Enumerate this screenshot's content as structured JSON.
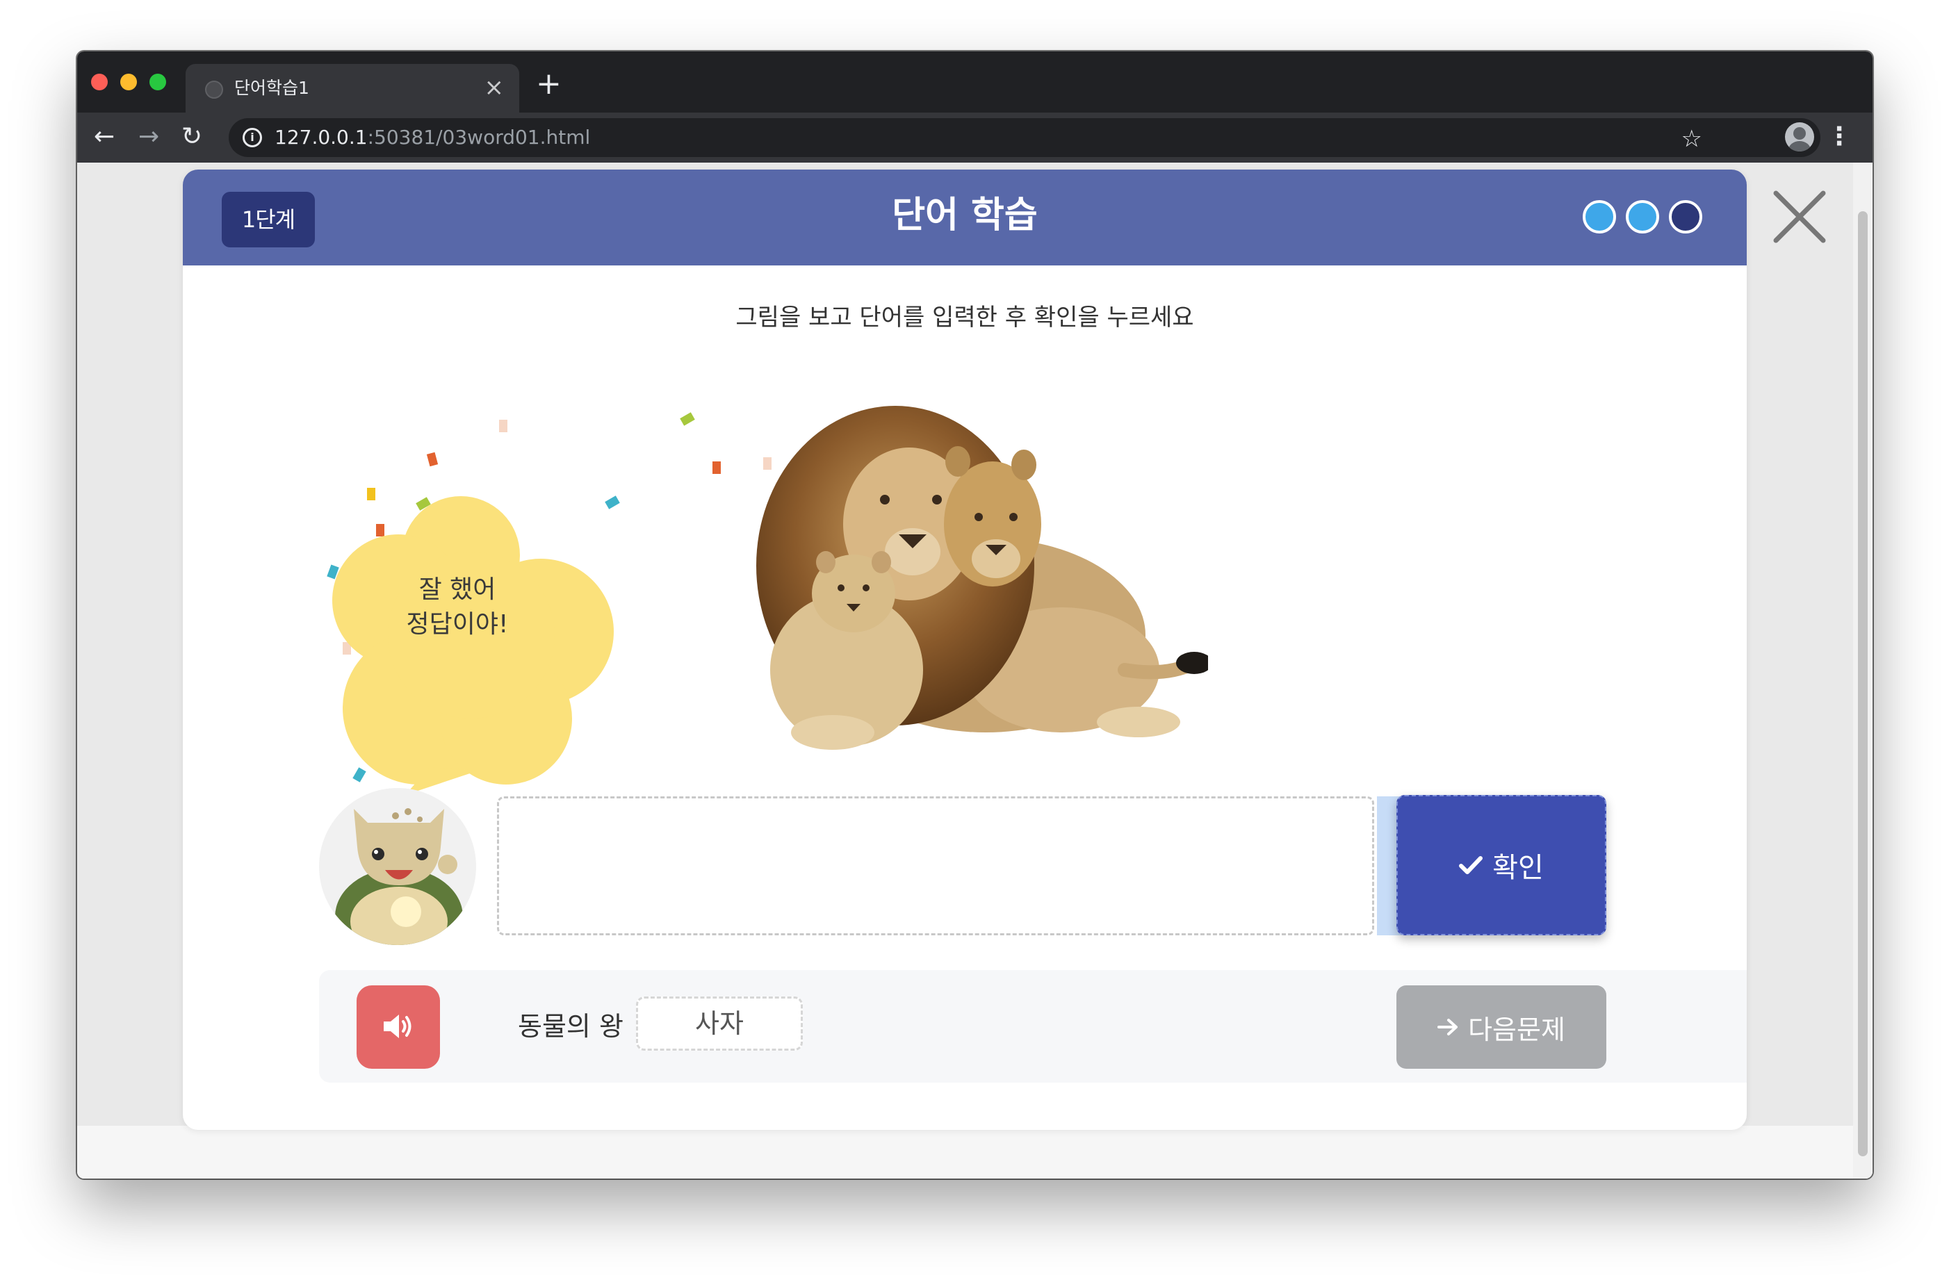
{
  "browser": {
    "tab_title": "단어학습1",
    "tab_close": "×",
    "new_tab": "+",
    "url_host": "127.0.0.1",
    "url_rest": ":50381/03word01.html"
  },
  "header": {
    "stage_label": "1단계",
    "title": "단어 학습",
    "progress_total": 3,
    "progress_completed": 2
  },
  "instruction": "그림을 보고 단어를 입력한 후 확인을 누르세요",
  "feedback": {
    "line1": "잘 했어",
    "line2": "정답이야!"
  },
  "answer_input": {
    "value": "",
    "placeholder": ""
  },
  "confirm_button": {
    "label": "확인"
  },
  "hint": {
    "label": "동물의 왕",
    "answer": "사자"
  },
  "next_button": {
    "label": "다음문제"
  },
  "icons": [
    "globe-icon",
    "close-tab-icon",
    "new-tab-icon",
    "back-icon",
    "forward-icon",
    "reload-icon",
    "info-icon",
    "bookmark-star-icon",
    "profile-icon",
    "menu-icon",
    "check-icon",
    "speaker-icon",
    "arrow-right-icon",
    "close-icon"
  ],
  "colors": {
    "header": "#5868a9",
    "stage_badge": "#2c3778",
    "confirm": "#3e4eb0",
    "sound": "#e46767",
    "next_disabled": "#a9abae",
    "bubble": "#fbe17b",
    "progress_done": "#3ea7e9",
    "progress_pending": "#2c3778"
  }
}
